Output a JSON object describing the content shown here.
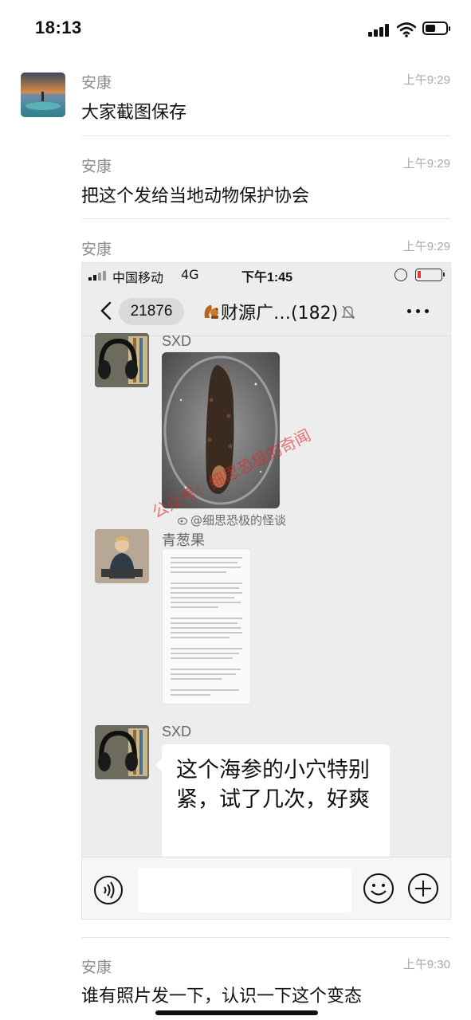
{
  "status_bar": {
    "time": "18:13"
  },
  "messages": [
    {
      "sender": "安康",
      "time": "上午9:29",
      "text": "大家截图保存"
    },
    {
      "sender": "安康",
      "time": "上午9:29",
      "text": "把这个发给当地动物保护协会"
    },
    {
      "sender": "安康",
      "time": "上午9:29"
    },
    {
      "sender": "安康",
      "time": "上午9:30",
      "text": "谁有照片发一下，认识一下这个变态"
    }
  ],
  "screenshot": {
    "status": {
      "carrier": "中国移动",
      "network": "4G",
      "time": "下午1:45"
    },
    "nav": {
      "unread_count": "21876",
      "title": "财源广…(182)"
    },
    "senders": [
      "SXD",
      "青葱果",
      "SXD"
    ],
    "bubble_text": "这个海参的小穴特别紧，试了几次，好爽",
    "watermark_weibo": "@细思恐极的怪谈",
    "watermark_red": "公众号：细思恐极的奇闻"
  },
  "colors": {
    "background": "#ffffff",
    "muted_text": "#8c8c8c",
    "chat_bg": "#ededed",
    "watermark_red": "#da2828"
  },
  "icons": [
    "signal-icon",
    "wifi-icon",
    "battery-icon",
    "back-chevron-icon",
    "squirrel-emoji-icon",
    "mute-bell-icon",
    "more-icon",
    "voice-icon",
    "emoji-icon",
    "plus-icon",
    "weibo-icon"
  ]
}
